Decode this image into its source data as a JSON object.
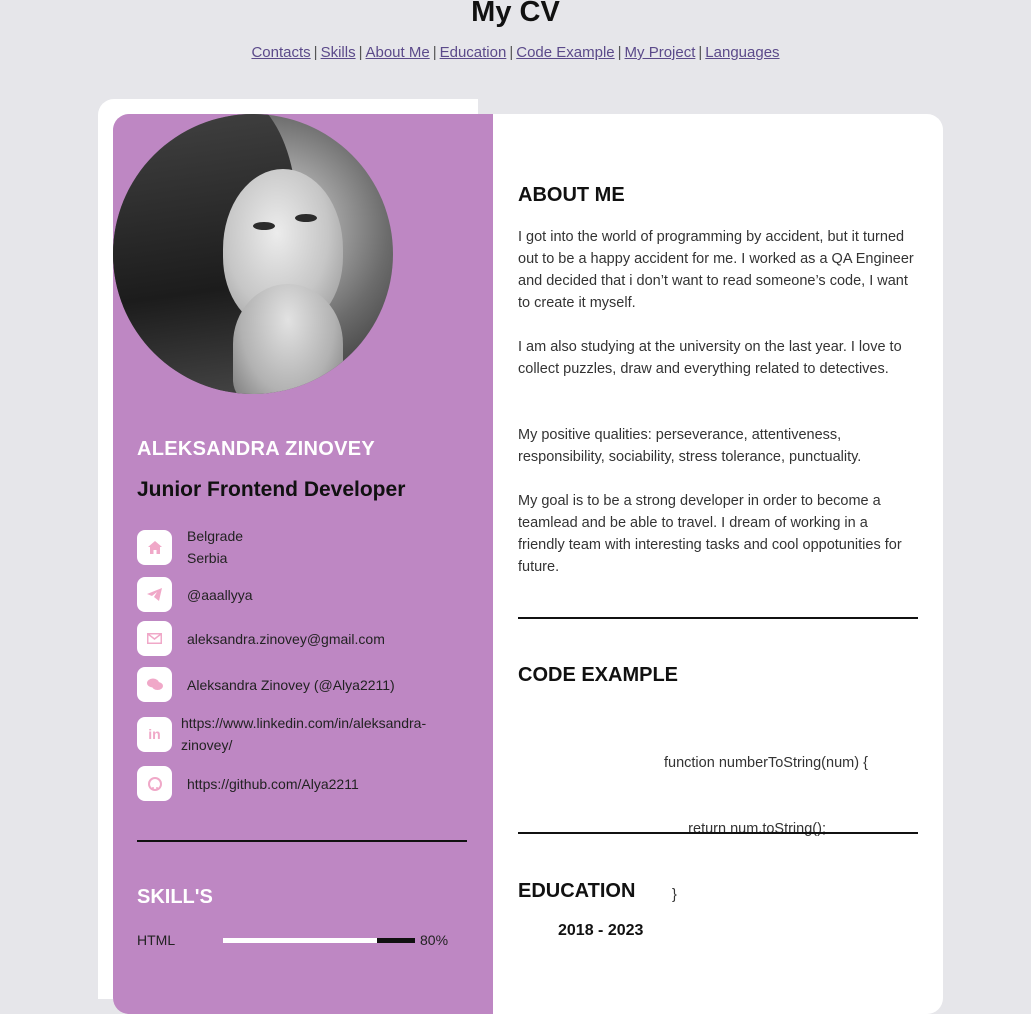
{
  "page": {
    "title": "My CV"
  },
  "nav": {
    "links": [
      "Contacts",
      "Skills",
      "About Me",
      "Education",
      "Code Example",
      "My Project",
      "Languages"
    ],
    "separator": "|"
  },
  "profile": {
    "name": "ALEKSANDRA ZINOVEY",
    "role": "Junior Frontend Developer"
  },
  "contacts": [
    {
      "icon": "home-icon",
      "lines": [
        "Belgrade",
        "Serbia"
      ]
    },
    {
      "icon": "telegram-icon",
      "lines": [
        "@aaallyya"
      ]
    },
    {
      "icon": "envelope-icon",
      "lines": [
        "aleksandra.zinovey@gmail.com"
      ]
    },
    {
      "icon": "chat-icon",
      "lines": [
        "Aleksandra Zinovey (@Alya2211)"
      ]
    },
    {
      "icon": "linkedin-icon",
      "lines": [
        "https://www.linkedin.com/in/aleksandra-",
        "zinovey/"
      ]
    },
    {
      "icon": "github-icon",
      "lines": [
        "https://github.com/Alya2211"
      ]
    }
  ],
  "skills": {
    "title": "SKILL'S",
    "items": [
      {
        "label": "HTML",
        "percent": 80,
        "percent_text": "80%"
      }
    ]
  },
  "about": {
    "title": "ABOUT ME",
    "paragraphs": [
      "I got into the world of programming by accident, but it turned out to be a happy accident for me. I worked as a QA Engineer and decided that i don’t want to read someone’s code, I want to create it myself.",
      "I am also studying at the university on the last year. I love to collect puzzles, draw and everything related to detectives.",
      "My positive qualities: perseverance, attentiveness, responsibility, sociability, stress tolerance, punctuality.",
      "My goal is to be a strong developer in order to become a teamlead and be able to travel. I dream of working in a friendly team with interesting tasks and cool oppotunities for future."
    ]
  },
  "code_example": {
    "title": "CODE EXAMPLE",
    "lines": [
      "function numberToString(num) {",
      "      return num.toString();",
      "  }"
    ]
  },
  "education": {
    "title": "EDUCATION",
    "years": "2018 - 2023"
  },
  "colors": {
    "background": "#e6e6ea",
    "sidebar": "#be87c3",
    "icon_tint": "#f0a8c8",
    "link": "#5b4a8a"
  }
}
